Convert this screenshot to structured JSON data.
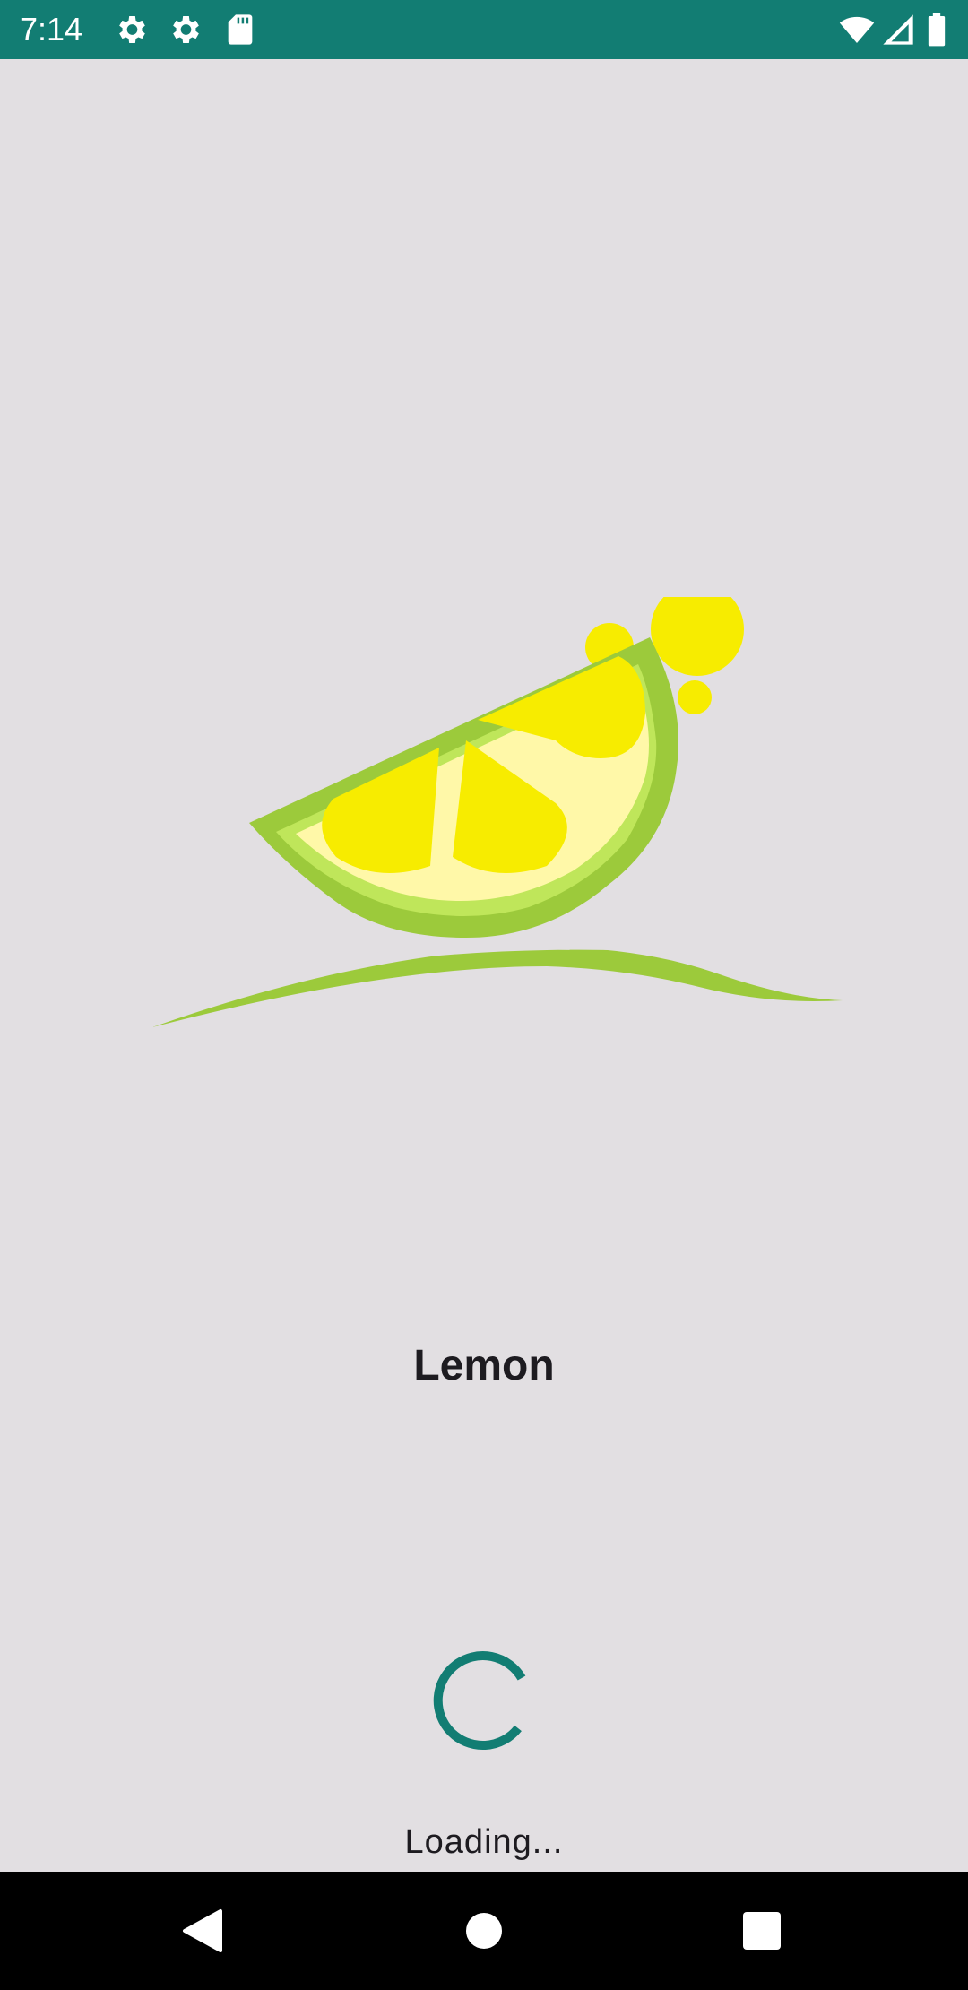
{
  "status_bar": {
    "time": "7:14",
    "left_icons": [
      "settings-icon",
      "settings-icon",
      "sd-card-icon"
    ],
    "right_icons": [
      "wifi-icon",
      "cell-signal-icon",
      "battery-icon"
    ],
    "background_color": "#127d73"
  },
  "splash": {
    "logo": "lemon-slice-logo",
    "app_name": "Lemon",
    "loading_text": "Loading...",
    "spinner_color": "#127d73",
    "background_color": "#e2dfe2"
  },
  "nav_bar": {
    "buttons": [
      "back",
      "home",
      "recents"
    ]
  }
}
